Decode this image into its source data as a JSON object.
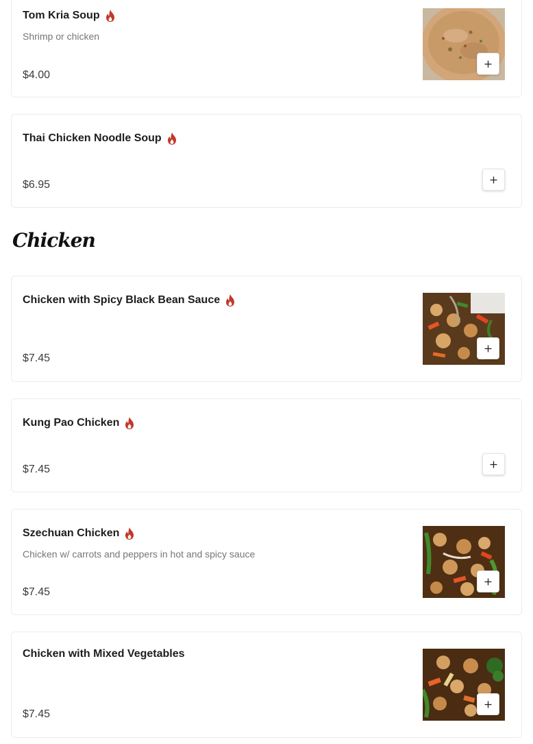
{
  "section_heading": "Chicken",
  "items": [
    {
      "name": "Tom Kria Soup",
      "spicy": true,
      "description": "Shrimp or chicken",
      "price": "$4.00",
      "photo": "soup-photo"
    },
    {
      "name": "Thai Chicken Noodle Soup",
      "spicy": true,
      "description": "",
      "price": "$6.95",
      "photo": ""
    },
    {
      "name": "Chicken with Spicy Black Bean Sauce",
      "spicy": true,
      "description": "",
      "price": "$7.45",
      "photo": "stir-fry-photo"
    },
    {
      "name": "Kung Pao Chicken",
      "spicy": true,
      "description": "",
      "price": "$7.45",
      "photo": ""
    },
    {
      "name": "Szechuan Chicken",
      "spicy": true,
      "description": "Chicken w/ carrots and peppers in hot and spicy sauce",
      "price": "$7.45",
      "photo": "stir-fry-photo"
    },
    {
      "name": "Chicken with Mixed Vegetables",
      "spicy": false,
      "description": "",
      "price": "$7.45",
      "photo": "stir-fry-photo"
    }
  ],
  "colors": {
    "spicy_icon": "#c0392b",
    "price": "#3a3a3a",
    "description": "#767676"
  }
}
